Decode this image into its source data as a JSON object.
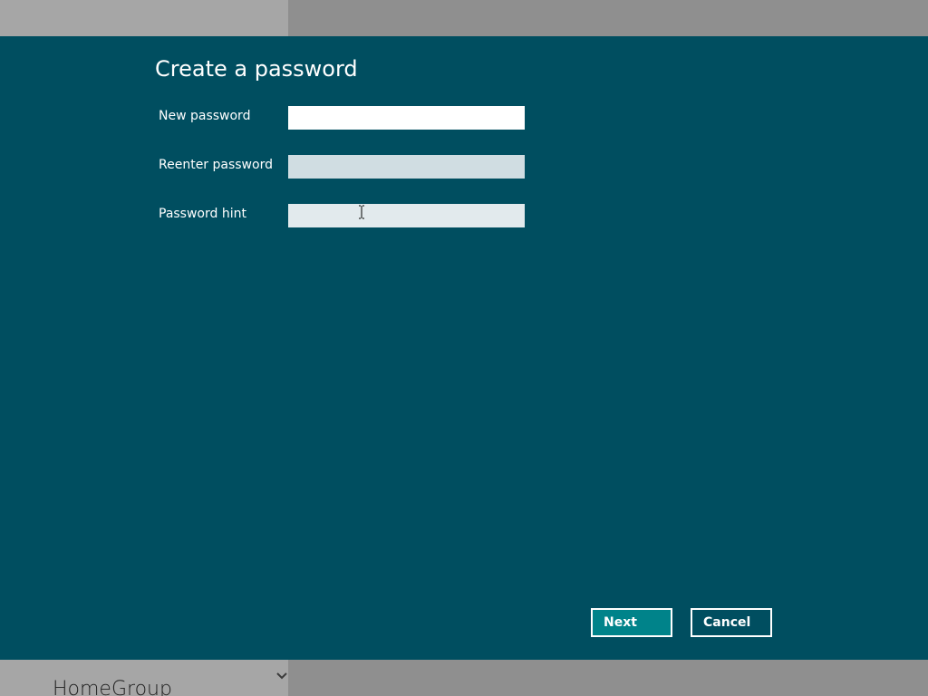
{
  "background": {
    "section_label": "HomeGroup"
  },
  "dialog": {
    "title": "Create a password",
    "fields": [
      {
        "label": "New password",
        "value": "",
        "placeholder": ""
      },
      {
        "label": "Reenter password",
        "value": "",
        "placeholder": ""
      },
      {
        "label": "Password hint",
        "value": "",
        "placeholder": ""
      }
    ],
    "buttons": {
      "next": "Next",
      "cancel": "Cancel"
    }
  },
  "colors": {
    "dialog_background": "#004e60",
    "next_button": "#00838a",
    "text": "#ffffff"
  },
  "icons": {
    "chevron": "chevron-down-icon",
    "cursor": "text-cursor-icon"
  }
}
